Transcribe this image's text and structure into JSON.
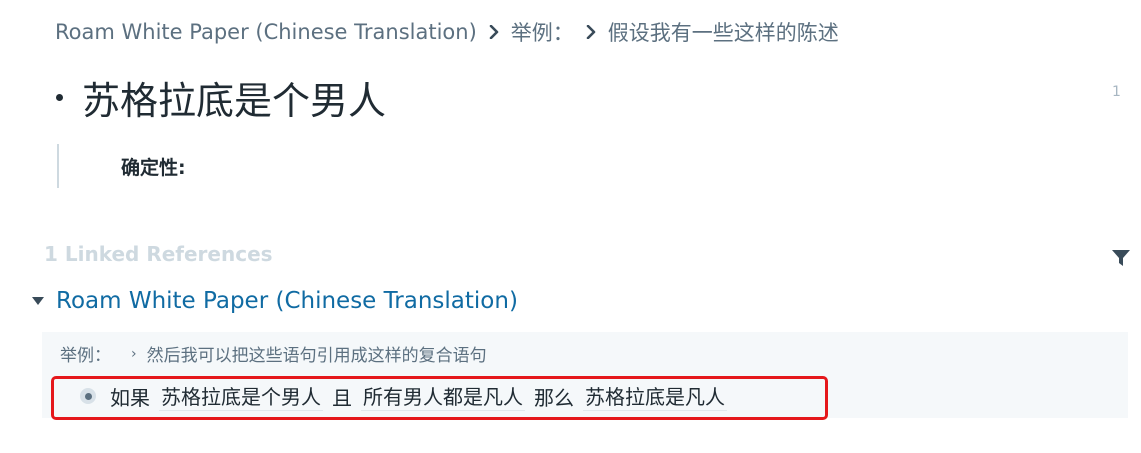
{
  "breadcrumb": {
    "items": [
      {
        "label": "Roam White Paper (Chinese Translation)"
      },
      {
        "label": "举例："
      },
      {
        "label": "假设我有一些这样的陈述"
      }
    ]
  },
  "page": {
    "title": "苏格拉底是个男人",
    "reference_count": "1",
    "attribute_label": "确定性:"
  },
  "linked_references": {
    "header": "1 Linked References",
    "filter_icon": "filter-icon",
    "groups": [
      {
        "page_link": "Roam White Paper (Chinese Translation)",
        "context_breadcrumb": {
          "parent": "举例：",
          "separator": "›",
          "child": "然后我可以把这些语句引用成这样的复合语句"
        },
        "block": {
          "if_word": "如果",
          "ref1": "苏格拉底是个男人",
          "and_word": "且",
          "ref2": "所有男人都是凡人",
          "then_word": "那么",
          "ref3": "苏格拉底是凡人"
        }
      }
    ]
  },
  "colors": {
    "link": "#106ba3",
    "highlight": "#e5171b",
    "muted": "#5c7080",
    "panel_bg": "#f5f8fa"
  }
}
